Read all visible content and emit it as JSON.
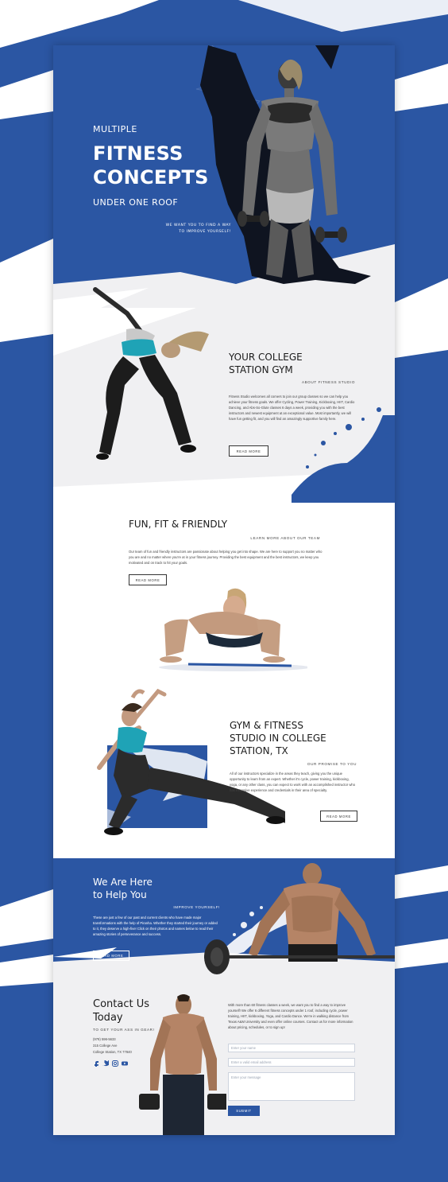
{
  "colors": {
    "brand_blue": "#2b56a3",
    "dark_text": "#1b1b1b",
    "light_gray": "#f0f0f2"
  },
  "hero": {
    "line1": "MULTIPLE",
    "line2": "FITNESS",
    "line3": "CONCEPTS",
    "line4": "UNDER ONE ROOF",
    "tagline1": "WE WANT YOU TO FIND A WAY",
    "tagline2": "TO IMPROVE YOURSELF!"
  },
  "about": {
    "title1": "YOUR COLLEGE",
    "title2": "STATION GYM",
    "eyebrow": "ABOUT FITNESS STUDIO",
    "body": "Fitness Studio welcomes all comers to join our group classes so we can help you achieve your fitness goals. We offer Cycling, Power Training, Kickboxing, HIIT, Cardio Dancing, and Abs-So-Glute classes 6 days a week, providing you with the best instructors and newest equipment at an exceptional value. Most importantly, we will have fun getting fit, and you will find an amazingly supportive family here.",
    "button": "READ MORE"
  },
  "team": {
    "title": "FUN, FIT & FRIENDLY",
    "eyebrow": "LEARN MORE ABOUT OUR TEAM",
    "body": "Our team of fun and friendly instructors are passionate about helping you get into shape. We are here to support you no matter who you are and no matter where you're at in your fitness journey. Providing the best equipment and the best instructors, we keep you motivated and on track to hit your goals.",
    "button": "READ MORE"
  },
  "studio": {
    "title1": "GYM & FITNESS",
    "title2": "STUDIO IN COLLEGE",
    "title3": "STATION, TX",
    "eyebrow": "OUR PROMISE TO YOU",
    "body": "All of our instructors specialize in the areas they teach, giving you the unique opportunity to learn from an expert. Whether it's cycle, power training, kickboxing, yoga, or any other class, you can expect to work with an accomplished instructor who has extensive experience and credentials in their area of specialty.",
    "button": "READ MORE"
  },
  "help": {
    "title1": "We Are Here",
    "title2": "to Help You",
    "eyebrow": "IMPROVE YOURSELF!",
    "body": "These are just a few of our past and current clients who have made major transformations with the help of Piranha. Whether they started their journey or added to it, they deserve a high-five! Click on their photos and names below to read their amazing stories of perseverance and success.",
    "button": "READ MORE"
  },
  "contact": {
    "title1": "Contact Us",
    "title2": "Today",
    "eyebrow": "TO GET YOUR ASS IN GEAR!",
    "phone": "(979) 596-5633",
    "address1": "315 College Ave",
    "address2": "College Station, TX 77840",
    "social": [
      "facebook-icon",
      "twitter-icon",
      "instagram-icon",
      "youtube-icon"
    ],
    "intro": "With more than 60 fitness classes a week, we want you to find a way to improve yourself! We offer 6 different fitness concepts under 1 roof, including cycle, power training, HIIT, kickboxing, Yoga, and Cardio Dance. We're in walking distance from Texas A&M University and even offer online courses. Contact us for more information about pricing, schedules, or to sign up!",
    "name_placeholder": "Enter your name",
    "email_placeholder": "Enter a valid email address",
    "message_placeholder": "Enter your message",
    "submit": "SUBMIT"
  }
}
